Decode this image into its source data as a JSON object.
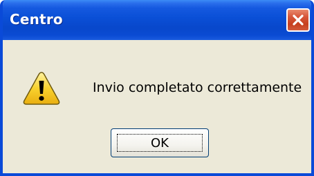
{
  "window": {
    "title": "Centro"
  },
  "dialog": {
    "message": "Invio completato correttamente",
    "icon": "warning-icon",
    "ok_label": "OK"
  },
  "titlebar": {
    "close_icon": "close-icon"
  },
  "colors": {
    "titlebar_blue": "#0A4FD6",
    "window_face": "#ECE9D8",
    "close_red": "#D7563A",
    "warning_yellow": "#F8D22E"
  }
}
